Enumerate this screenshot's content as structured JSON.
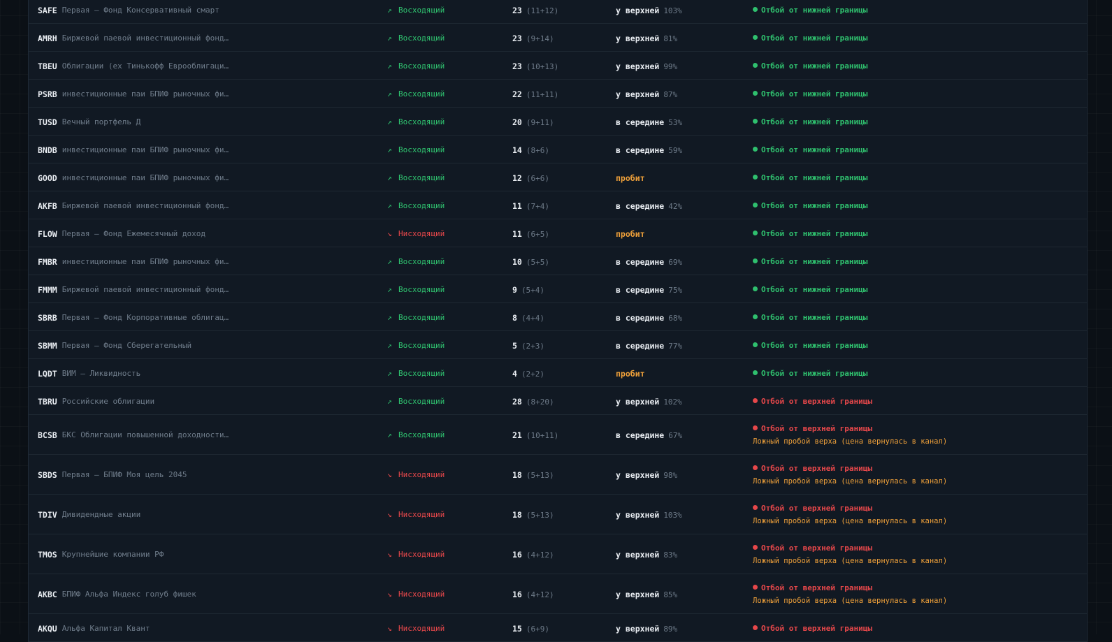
{
  "colors": {
    "up": "#2fc06e",
    "down": "#e6474a",
    "warning": "#f0a13a",
    "background": "#0b1016",
    "panel": "#111923"
  },
  "rows": [
    {
      "ticker": "SAFE",
      "name": "Первая – Фонд Консервативный смарт",
      "trend": "Восходящий",
      "trend_dir": "up",
      "score": "23",
      "score_detail": "(11+12)",
      "position": "у верхней",
      "position_pct": "103%",
      "signal": "Отбой от нижней границы",
      "signal_type": "green",
      "note": ""
    },
    {
      "ticker": "AMRH",
      "name": "Биржевой паевой инвестиционный фонд…",
      "trend": "Восходящий",
      "trend_dir": "up",
      "score": "23",
      "score_detail": "(9+14)",
      "position": "у верхней",
      "position_pct": "81%",
      "signal": "Отбой от нижней границы",
      "signal_type": "green",
      "note": ""
    },
    {
      "ticker": "TBEU",
      "name": "Облигации (ex Тинькофф Еврооблигаци…",
      "trend": "Восходящий",
      "trend_dir": "up",
      "score": "23",
      "score_detail": "(10+13)",
      "position": "у верхней",
      "position_pct": "99%",
      "signal": "Отбой от нижней границы",
      "signal_type": "green",
      "note": ""
    },
    {
      "ticker": "PSRB",
      "name": "инвестиционные паи БПИФ рыночных фи…",
      "trend": "Восходящий",
      "trend_dir": "up",
      "score": "22",
      "score_detail": "(11+11)",
      "position": "у верхней",
      "position_pct": "87%",
      "signal": "Отбой от нижней границы",
      "signal_type": "green",
      "note": ""
    },
    {
      "ticker": "TUSD",
      "name": "Вечный портфель Д",
      "trend": "Восходящий",
      "trend_dir": "up",
      "score": "20",
      "score_detail": "(9+11)",
      "position": "в середине",
      "position_pct": "53%",
      "signal": "Отбой от нижней границы",
      "signal_type": "green",
      "note": ""
    },
    {
      "ticker": "BNDB",
      "name": "инвестиционные паи БПИФ рыночных фи…",
      "trend": "Восходящий",
      "trend_dir": "up",
      "score": "14",
      "score_detail": "(8+6)",
      "position": "в середине",
      "position_pct": "59%",
      "signal": "Отбой от нижней границы",
      "signal_type": "green",
      "note": ""
    },
    {
      "ticker": "GOOD",
      "name": "инвестиционные паи БПИФ рыночных фи…",
      "trend": "Восходящий",
      "trend_dir": "up",
      "score": "12",
      "score_detail": "(6+6)",
      "position": "пробит",
      "position_pct": "",
      "signal": "Отбой от нижней границы",
      "signal_type": "green",
      "note": ""
    },
    {
      "ticker": "AKFB",
      "name": "Биржевой паевой инвестиционный фонд…",
      "trend": "Восходящий",
      "trend_dir": "up",
      "score": "11",
      "score_detail": "(7+4)",
      "position": "в середине",
      "position_pct": "42%",
      "signal": "Отбой от нижней границы",
      "signal_type": "green",
      "note": ""
    },
    {
      "ticker": "FLOW",
      "name": "Первая – Фонд Ежемесячный доход",
      "trend": "Нисходящий",
      "trend_dir": "down",
      "score": "11",
      "score_detail": "(6+5)",
      "position": "пробит",
      "position_pct": "",
      "signal": "Отбой от нижней границы",
      "signal_type": "green",
      "note": ""
    },
    {
      "ticker": "FMBR",
      "name": "инвестиционные паи БПИФ рыночных фи…",
      "trend": "Восходящий",
      "trend_dir": "up",
      "score": "10",
      "score_detail": "(5+5)",
      "position": "в середине",
      "position_pct": "69%",
      "signal": "Отбой от нижней границы",
      "signal_type": "green",
      "note": ""
    },
    {
      "ticker": "FMMM",
      "name": "Биржевой паевой инвестиционный фонд…",
      "trend": "Восходящий",
      "trend_dir": "up",
      "score": "9",
      "score_detail": "(5+4)",
      "position": "в середине",
      "position_pct": "75%",
      "signal": "Отбой от нижней границы",
      "signal_type": "green",
      "note": ""
    },
    {
      "ticker": "SBRB",
      "name": "Первая – Фонд Корпоративные облигац…",
      "trend": "Восходящий",
      "trend_dir": "up",
      "score": "8",
      "score_detail": "(4+4)",
      "position": "в середине",
      "position_pct": "68%",
      "signal": "Отбой от нижней границы",
      "signal_type": "green",
      "note": ""
    },
    {
      "ticker": "SBMM",
      "name": "Первая – Фонд Сберегательный",
      "trend": "Восходящий",
      "trend_dir": "up",
      "score": "5",
      "score_detail": "(2+3)",
      "position": "в середине",
      "position_pct": "77%",
      "signal": "Отбой от нижней границы",
      "signal_type": "green",
      "note": ""
    },
    {
      "ticker": "LQDT",
      "name": "ВИМ – Ликвидность",
      "trend": "Восходящий",
      "trend_dir": "up",
      "score": "4",
      "score_detail": "(2+2)",
      "position": "пробит",
      "position_pct": "",
      "signal": "Отбой от нижней границы",
      "signal_type": "green",
      "note": ""
    },
    {
      "ticker": "TBRU",
      "name": "Российские облигации",
      "trend": "Восходящий",
      "trend_dir": "up",
      "score": "28",
      "score_detail": "(8+20)",
      "position": "у верхней",
      "position_pct": "102%",
      "signal": "Отбой от верхней границы",
      "signal_type": "red",
      "note": ""
    },
    {
      "ticker": "BCSB",
      "name": "БКС Облигации повышенной доходности…",
      "trend": "Восходящий",
      "trend_dir": "up",
      "score": "21",
      "score_detail": "(10+11)",
      "position": "в середине",
      "position_pct": "67%",
      "signal": "Отбой от верхней границы",
      "signal_type": "red",
      "note": "Ложный пробой верха (цена вернулась в канал)"
    },
    {
      "ticker": "SBDS",
      "name": "Первая – БПИФ Моя цель 2045",
      "trend": "Нисходящий",
      "trend_dir": "down",
      "score": "18",
      "score_detail": "(5+13)",
      "position": "у верхней",
      "position_pct": "98%",
      "signal": "Отбой от верхней границы",
      "signal_type": "red",
      "note": "Ложный пробой верха (цена вернулась в канал)"
    },
    {
      "ticker": "TDIV",
      "name": "Дивидендные акции",
      "trend": "Нисходящий",
      "trend_dir": "down",
      "score": "18",
      "score_detail": "(5+13)",
      "position": "у верхней",
      "position_pct": "103%",
      "signal": "Отбой от верхней границы",
      "signal_type": "red",
      "note": "Ложный пробой верха (цена вернулась в канал)"
    },
    {
      "ticker": "TMOS",
      "name": "Крупнейшие компании РФ",
      "trend": "Нисходящий",
      "trend_dir": "down",
      "score": "16",
      "score_detail": "(4+12)",
      "position": "у верхней",
      "position_pct": "83%",
      "signal": "Отбой от верхней границы",
      "signal_type": "red",
      "note": "Ложный пробой верха (цена вернулась в канал)"
    },
    {
      "ticker": "AKBC",
      "name": "БПИФ Альфа Индекс голуб фишек",
      "trend": "Нисходящий",
      "trend_dir": "down",
      "score": "16",
      "score_detail": "(4+12)",
      "position": "у верхней",
      "position_pct": "85%",
      "signal": "Отбой от верхней границы",
      "signal_type": "red",
      "note": "Ложный пробой верха (цена вернулась в канал)"
    },
    {
      "ticker": "AKQU",
      "name": "Альфа Капитал Квант",
      "trend": "Нисходящий",
      "trend_dir": "down",
      "score": "15",
      "score_detail": "(6+9)",
      "position": "у верхней",
      "position_pct": "89%",
      "signal": "Отбой от верхней границы",
      "signal_type": "red",
      "note": ""
    }
  ]
}
